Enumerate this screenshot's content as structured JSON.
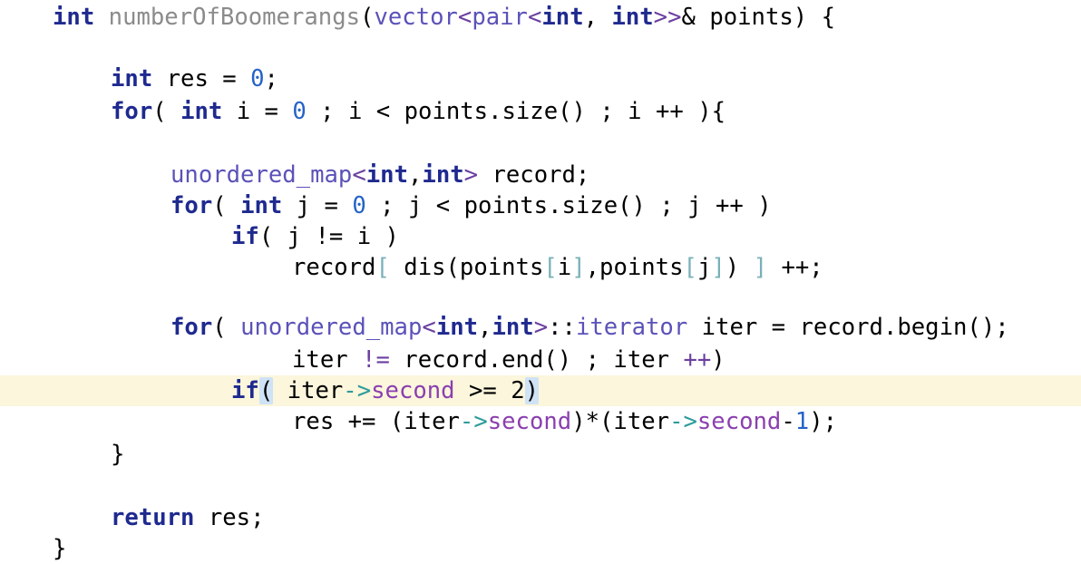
{
  "editor": {
    "lines": [
      {
        "tokens": [
          {
            "t": "kw",
            "v": "int"
          },
          {
            "t": "p",
            "v": " "
          },
          {
            "t": "fn",
            "v": "numberOfBoomerangs"
          },
          {
            "t": "p",
            "v": "("
          },
          {
            "t": "ty",
            "v": "vector"
          },
          {
            "t": "op",
            "v": "<"
          },
          {
            "t": "ty",
            "v": "pair"
          },
          {
            "t": "op",
            "v": "<"
          },
          {
            "t": "kw",
            "v": "int"
          },
          {
            "t": "p",
            "v": ", "
          },
          {
            "t": "kw",
            "v": "int"
          },
          {
            "t": "op",
            "v": ">>"
          },
          {
            "t": "p",
            "v": "& points) {"
          }
        ]
      },
      {
        "tokens": []
      },
      {
        "tokens": [
          {
            "t": "kw",
            "v": "int"
          },
          {
            "t": "p",
            "v": " res = "
          },
          {
            "t": "num",
            "v": "0"
          },
          {
            "t": "p",
            "v": ";"
          }
        ]
      },
      {
        "tokens": [
          {
            "t": "kw",
            "v": "for"
          },
          {
            "t": "p",
            "v": "( "
          },
          {
            "t": "kw",
            "v": "int"
          },
          {
            "t": "p",
            "v": " i = "
          },
          {
            "t": "num",
            "v": "0"
          },
          {
            "t": "p",
            "v": " ; i < points.size() ; i ++ ){"
          }
        ]
      },
      {
        "tokens": []
      },
      {
        "tokens": [
          {
            "t": "ty",
            "v": "unordered_map"
          },
          {
            "t": "op",
            "v": "<"
          },
          {
            "t": "kw",
            "v": "int"
          },
          {
            "t": "p",
            "v": ","
          },
          {
            "t": "kw",
            "v": "int"
          },
          {
            "t": "op",
            "v": ">"
          },
          {
            "t": "p",
            "v": " record;"
          }
        ]
      },
      {
        "tokens": [
          {
            "t": "kw",
            "v": "for"
          },
          {
            "t": "p",
            "v": "( "
          },
          {
            "t": "kw",
            "v": "int"
          },
          {
            "t": "p",
            "v": " j = "
          },
          {
            "t": "num",
            "v": "0"
          },
          {
            "t": "p",
            "v": " ; j < points.size() ; j ++ )"
          }
        ]
      },
      {
        "tokens": [
          {
            "t": "kw",
            "v": "if"
          },
          {
            "t": "p",
            "v": "( j != i )"
          }
        ]
      },
      {
        "tokens": [
          {
            "t": "p",
            "v": "record"
          },
          {
            "t": "brk",
            "v": "["
          },
          {
            "t": "p",
            "v": " dis(points"
          },
          {
            "t": "brk",
            "v": "["
          },
          {
            "t": "p",
            "v": "i"
          },
          {
            "t": "brk",
            "v": "]"
          },
          {
            "t": "p",
            "v": ",points"
          },
          {
            "t": "brk",
            "v": "["
          },
          {
            "t": "p",
            "v": "j"
          },
          {
            "t": "brk",
            "v": "]"
          },
          {
            "t": "p",
            "v": ") "
          },
          {
            "t": "brk",
            "v": "]"
          },
          {
            "t": "p",
            "v": " ++;"
          }
        ]
      },
      {
        "tokens": []
      },
      {
        "tokens": [
          {
            "t": "kw",
            "v": "for"
          },
          {
            "t": "p",
            "v": "( "
          },
          {
            "t": "ty",
            "v": "unordered_map"
          },
          {
            "t": "op",
            "v": "<"
          },
          {
            "t": "kw",
            "v": "int"
          },
          {
            "t": "p",
            "v": ","
          },
          {
            "t": "kw",
            "v": "int"
          },
          {
            "t": "op",
            "v": ">"
          },
          {
            "t": "p",
            "v": "::"
          },
          {
            "t": "it",
            "v": "iterator"
          },
          {
            "t": "p",
            "v": " iter = record.begin();"
          }
        ]
      },
      {
        "tokens": [
          {
            "t": "p",
            "v": "iter "
          },
          {
            "t": "op",
            "v": "!="
          },
          {
            "t": "p",
            "v": " record.end() ; iter "
          },
          {
            "t": "op",
            "v": "++"
          },
          {
            "t": "p",
            "v": ")"
          }
        ]
      },
      {
        "tokens": [
          {
            "t": "kw",
            "v": "if"
          },
          {
            "t": "hl",
            "v": "("
          },
          {
            "t": "p",
            "v": " iter"
          },
          {
            "t": "arrow",
            "v": "->"
          },
          {
            "t": "field",
            "v": "second"
          },
          {
            "t": "p",
            "v": " >= 2"
          },
          {
            "t": "hl",
            "v": ")"
          }
        ]
      },
      {
        "tokens": [
          {
            "t": "p",
            "v": "res += (iter"
          },
          {
            "t": "arrow",
            "v": "->"
          },
          {
            "t": "field",
            "v": "second"
          },
          {
            "t": "p",
            "v": ")*(iter"
          },
          {
            "t": "arrow",
            "v": "->"
          },
          {
            "t": "field",
            "v": "second"
          },
          {
            "t": "p",
            "v": "-"
          },
          {
            "t": "num",
            "v": "1"
          },
          {
            "t": "p",
            "v": ");"
          }
        ]
      },
      {
        "tokens": [
          {
            "t": "p",
            "v": "}"
          }
        ]
      },
      {
        "tokens": []
      },
      {
        "tokens": [
          {
            "t": "kw",
            "v": "return"
          },
          {
            "t": "p",
            "v": " res;"
          }
        ]
      },
      {
        "tokens": [
          {
            "t": "p",
            "v": "}"
          }
        ]
      }
    ]
  }
}
